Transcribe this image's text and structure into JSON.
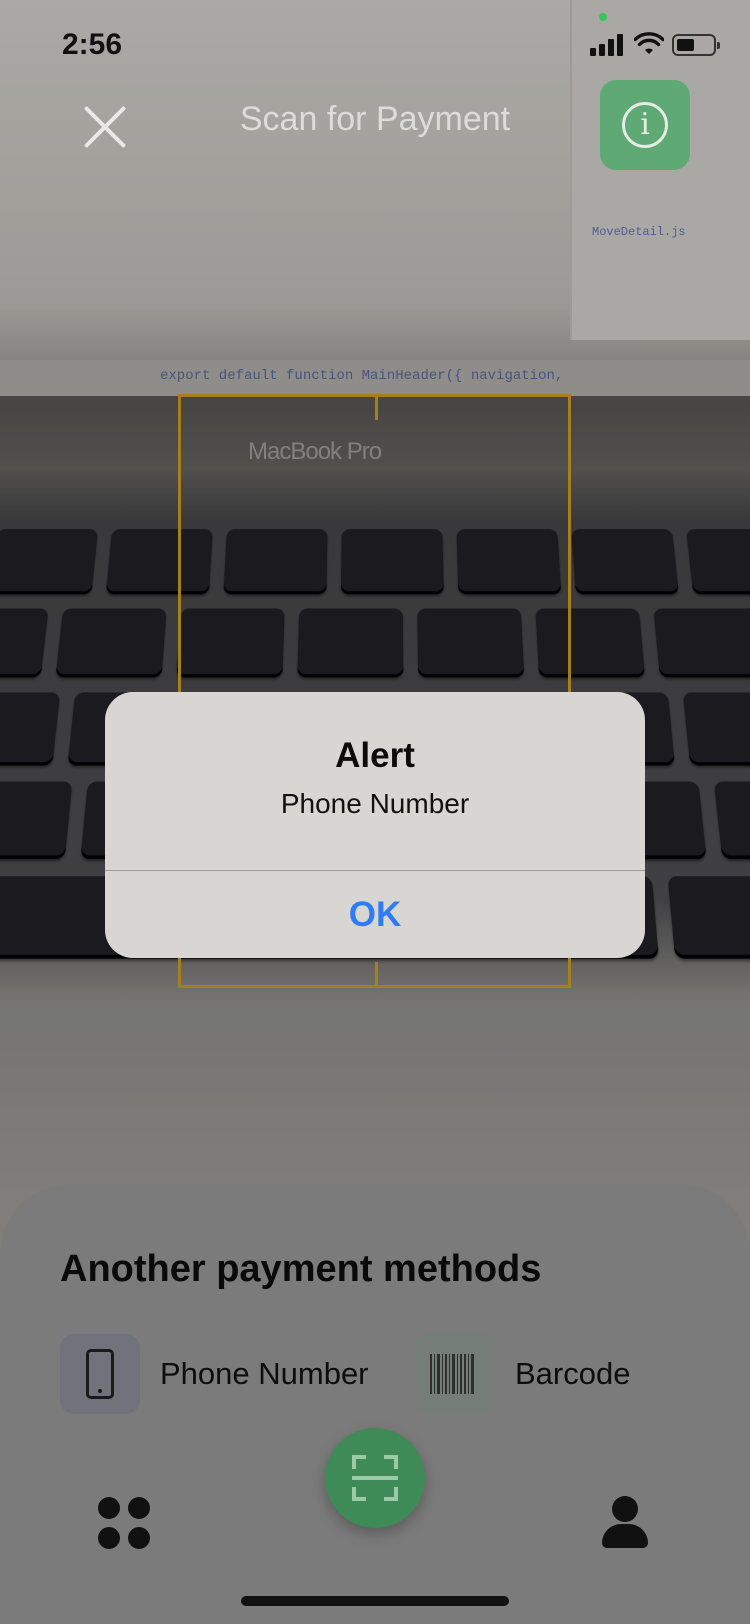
{
  "status_bar": {
    "time": "2:56"
  },
  "header": {
    "title": "Scan for Payment",
    "close_icon": "close-icon",
    "info_icon": "info-icon"
  },
  "alert": {
    "title": "Alert",
    "message": "Phone Number",
    "ok_label": "OK"
  },
  "sheet": {
    "title": "Another payment methods",
    "methods": [
      {
        "label": "Phone Number",
        "icon": "phone-icon"
      },
      {
        "label": "Barcode",
        "icon": "barcode-icon"
      }
    ]
  },
  "nav": {
    "items": [
      {
        "icon": "apps-grid-icon"
      },
      {
        "icon": "scan-icon"
      },
      {
        "icon": "profile-icon"
      }
    ]
  },
  "colors": {
    "accent_green": "#3f8b57",
    "alert_button_blue": "#2f7cf6",
    "viewfinder_gold": "#b38a1e"
  },
  "camera": {
    "laptop_brand": "MacBook Pro",
    "code_line": "export default function MainHeader({ navigation,",
    "code_file": "MoveDetail.js"
  }
}
